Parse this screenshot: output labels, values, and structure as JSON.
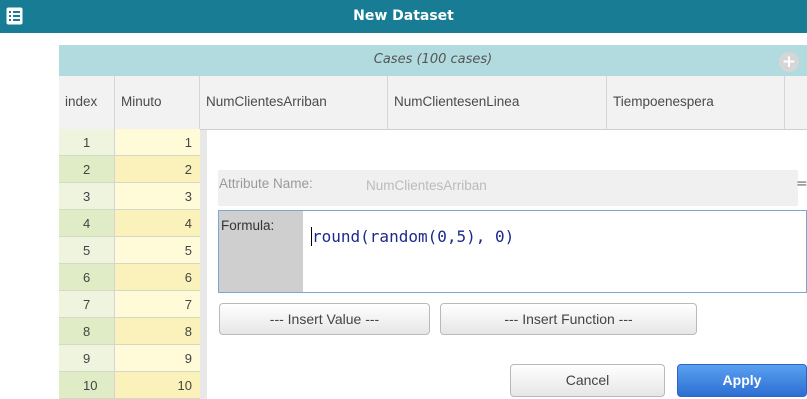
{
  "window": {
    "title": "New Dataset"
  },
  "cases_header": {
    "label": "Cases (100 cases)"
  },
  "columns": [
    "index",
    "Minuto",
    "NumClientesArriban",
    "NumClientesenLinea",
    "Tiempoenespera"
  ],
  "rows": [
    {
      "index": "1",
      "minuto": "1"
    },
    {
      "index": "2",
      "minuto": "2"
    },
    {
      "index": "3",
      "minuto": "3"
    },
    {
      "index": "4",
      "minuto": "4"
    },
    {
      "index": "5",
      "minuto": "5"
    },
    {
      "index": "6",
      "minuto": "6"
    },
    {
      "index": "7",
      "minuto": "7"
    },
    {
      "index": "8",
      "minuto": "8"
    },
    {
      "index": "9",
      "minuto": "9"
    },
    {
      "index": "10",
      "minuto": "10"
    }
  ],
  "attribute_editor": {
    "attr_label": "Attribute Name:",
    "attr_value": "NumClientesArriban",
    "eq": "=",
    "formula_label": "Formula:",
    "formula": "round(random(0,5), 0)"
  },
  "buttons": {
    "insert_value": "--- Insert Value ---",
    "insert_function": "--- Insert Function ---",
    "cancel": "Cancel",
    "apply": "Apply"
  },
  "icons": {
    "menu": "table-menu-icon",
    "add": "add-attribute-icon"
  },
  "colors": {
    "titlebar": "#187c95",
    "cases_bar": "#b2dbe0",
    "apply": "#2c6fd3"
  }
}
